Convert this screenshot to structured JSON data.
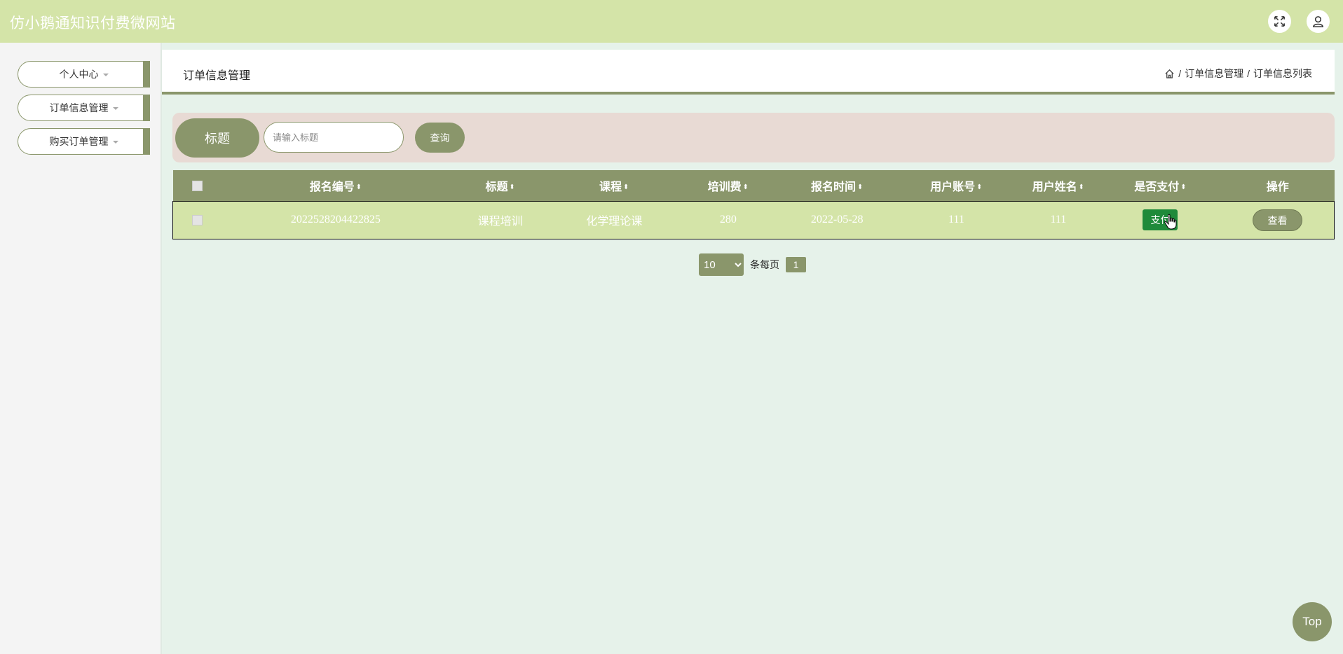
{
  "app": {
    "title": "仿小鹅通知识付费微网站"
  },
  "topbar": {
    "icons": [
      "fullscreen-icon",
      "user-icon"
    ]
  },
  "sidebar": {
    "items": [
      {
        "label": "个人中心"
      },
      {
        "label": "订单信息管理"
      },
      {
        "label": "购买订单管理"
      }
    ]
  },
  "header": {
    "title": "订单信息管理",
    "breadcrumb": {
      "home_icon": "home-icon",
      "sep1": "/",
      "crumb1": "订单信息管理",
      "sep2": "/",
      "crumb2": "订单信息列表"
    }
  },
  "search": {
    "label": "标题",
    "placeholder": "请输入标题",
    "value": "",
    "button": "查询"
  },
  "table": {
    "columns": [
      "报名编号",
      "标题",
      "课程",
      "培训费",
      "报名时间",
      "用户账号",
      "用户姓名",
      "是否支付",
      "操作"
    ],
    "sortable": [
      true,
      true,
      true,
      true,
      true,
      true,
      true,
      true,
      false
    ],
    "rows": [
      {
        "id": "2022528204422825",
        "title": "课程培训",
        "course": "化学理论课",
        "fee": "280",
        "date": "2022-05-28",
        "account": "111",
        "name": "111",
        "pay": "支付",
        "action": "查看"
      }
    ]
  },
  "pagination": {
    "page_size": "10",
    "per_page_label": "条每页",
    "current_page": "1",
    "page_size_options": [
      "10"
    ]
  },
  "back_to_top": "Top",
  "colors": {
    "topbar": "#d4e4a8",
    "accent": "#8a966b",
    "pay": "#1f8a3a",
    "search_panel": "#e8dad4",
    "body": "#e6f2ea"
  }
}
